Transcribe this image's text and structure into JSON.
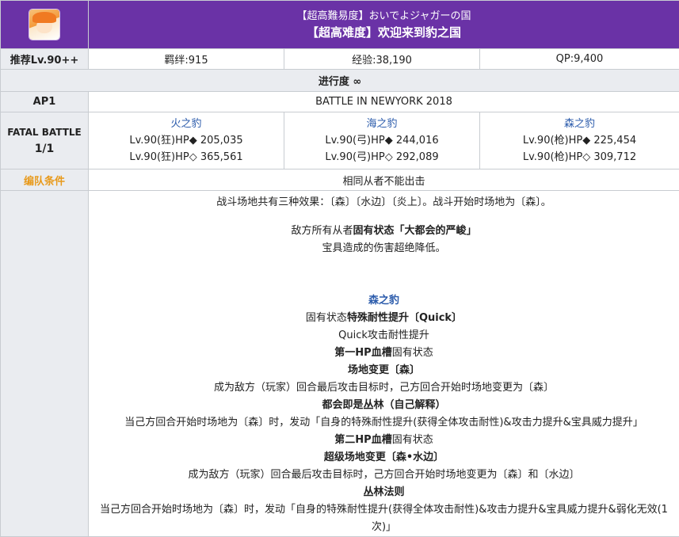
{
  "header": {
    "title_jp": "【超高難易度】おいでよジャガーの国",
    "title_cn": "【超高难度】欢迎来到豹之国",
    "icon": "servant-portrait-icon"
  },
  "info": {
    "level": "推荐Lv.90++",
    "bond": "羁绊:915",
    "exp": "经验:38,190",
    "qp": "QP:9,400"
  },
  "progress": "进行度 ∞",
  "ap": {
    "label": "AP1",
    "battle": "BATTLE IN NEWYORK 2018"
  },
  "fatal": {
    "label": "FATAL BATTLE",
    "count": "1/1",
    "enemies": [
      {
        "name": "火之豹",
        "line1": "Lv.90(狂)HP◆ 205,035",
        "line2": "Lv.90(狂)HP◇ 365,561"
      },
      {
        "name": "海之豹",
        "line1": "Lv.90(弓)HP◆ 244,016",
        "line2": "Lv.90(弓)HP◇ 292,089"
      },
      {
        "name": "森之豹",
        "line1": "Lv.90(枪)HP◆ 225,454",
        "line2": "Lv.90(枪)HP◇ 309,712"
      }
    ]
  },
  "formation": {
    "label": "编队条件",
    "value": "相同从者不能出击"
  },
  "notes": {
    "field": "战斗场地共有三种效果：〔森〕〔水边〕〔炎上〕。战斗开始时场地为〔森〕。",
    "enemy_all_prefix": "敌方所有从者",
    "enemy_all_bold": "固有状态「大都会的严峻」",
    "np_reduce": "宝具造成的伤害超绝降低。",
    "boss_name": "森之豹",
    "s1_prefix": "固有状态",
    "s1_bold": "特殊耐性提升〔Quick〕",
    "s1_desc": "Quick攻击耐性提升",
    "s2_bold": "第一HP血槽",
    "s2_suffix": "固有状态",
    "s3_bold": "场地变更〔森〕",
    "s3_desc": "成为敌方（玩家）回合最后攻击目标时，己方回合开始时场地变更为〔森〕",
    "s4_bold": "都会即是丛林（自己解释）",
    "s4_desc": "当己方回合开始时场地为〔森〕时，发动「自身的特殊耐性提升(获得全体攻击耐性)&攻击力提升&宝具威力提升」",
    "s5_bold": "第二HP血槽",
    "s5_suffix": "固有状态",
    "s6_bold": "超级场地变更〔森•水边〕",
    "s6_desc": "成为敌方（玩家）回合最后攻击目标时，己方回合开始时场地变更为〔森〕和〔水边〕",
    "s7_bold": "丛林法则",
    "s7_desc": "当己方回合开始时场地为〔森〕时，发动「自身的特殊耐性提升(获得全体攻击耐性)&攻击力提升&宝具威力提升&弱化无效(1次)」"
  }
}
